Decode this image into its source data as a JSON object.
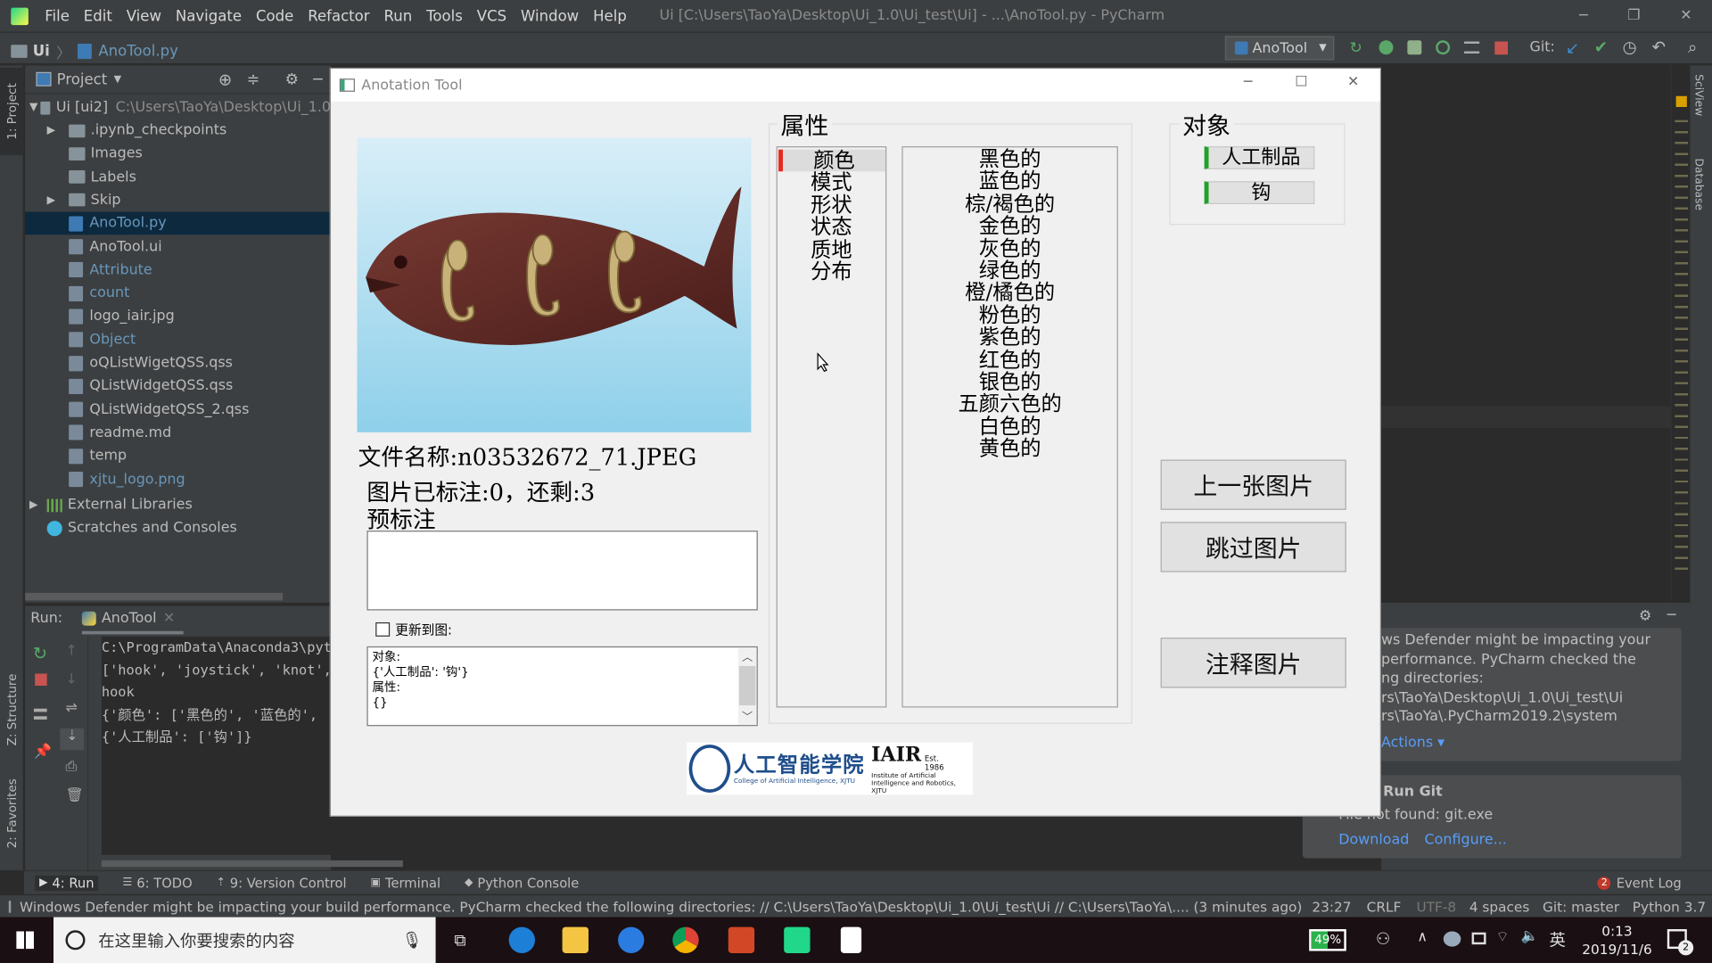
{
  "ide": {
    "menu": [
      "File",
      "Edit",
      "View",
      "Navigate",
      "Code",
      "Refactor",
      "Run",
      "Tools",
      "VCS",
      "Window",
      "Help"
    ],
    "window_title": "Ui [C:\\Users\\TaoYa\\Desktop\\Ui_1.0\\Ui_test\\Ui] - ...\\AnoTool.py - PyCharm",
    "breadcrumb": [
      "Ui",
      "AnoTool.py"
    ],
    "run_config": "AnoTool",
    "git_label": "Git:",
    "left_strip": [
      "1: Project",
      "Z: Structure",
      "2: Favorites"
    ],
    "right_strip": [
      "SciView",
      "Database"
    ],
    "project": {
      "header": "Project",
      "root": "Ui [ui2]",
      "root_path": "C:\\Users\\TaoYa\\Desktop\\Ui_1.0",
      "items": [
        {
          "label": ".ipynb_checkpoints",
          "type": "folder",
          "expandable": true
        },
        {
          "label": "Images",
          "type": "folder"
        },
        {
          "label": "Labels",
          "type": "folder"
        },
        {
          "label": "Skip",
          "type": "folder",
          "expandable": true
        },
        {
          "label": "AnoTool.py",
          "type": "py",
          "selected": true
        },
        {
          "label": "AnoTool.ui",
          "type": "file"
        },
        {
          "label": "Attribute",
          "type": "file",
          "color": "blue"
        },
        {
          "label": "count",
          "type": "file",
          "color": "blue"
        },
        {
          "label": "logo_iair.jpg",
          "type": "file"
        },
        {
          "label": "Object",
          "type": "file",
          "color": "blue"
        },
        {
          "label": "oQListWigetQSS.qss",
          "type": "file"
        },
        {
          "label": "QListWidgetQSS.qss",
          "type": "file"
        },
        {
          "label": "QListWidgetQSS_2.qss",
          "type": "file"
        },
        {
          "label": "readme.md",
          "type": "file"
        },
        {
          "label": "temp",
          "type": "file"
        },
        {
          "label": "xjtu_logo.png",
          "type": "file",
          "color": "blue"
        }
      ],
      "external": "External Libraries",
      "scratches": "Scratches and Consoles"
    },
    "run": {
      "label": "Run:",
      "tab": "AnoTool",
      "lines": [
        "C:\\ProgramData\\Anaconda3\\pyth",
        "['hook', 'joystick', 'knot',",
        "hook",
        "{'颜色': ['黑色的', '蓝色的',",
        "{'人工制品': ['钩']}"
      ]
    },
    "notifications": {
      "defender_lines": [
        "ws Defender might be impacting your",
        "performance. PyCharm checked the",
        "ng directories:",
        "rs\\TaoYa\\Desktop\\Ui_1.0\\Ui_test\\Ui",
        "rs\\TaoYa\\.PyCharm2019.2\\system"
      ],
      "actions": "Actions ▾",
      "git_title": "t Run Git",
      "git_msg": "File not found: git.exe",
      "download": "Download",
      "configure": "Configure..."
    },
    "bottom_tabs": [
      "4: Run",
      "6: TODO",
      "9: Version Control",
      "Terminal",
      "Python Console"
    ],
    "event_log": "Event Log",
    "event_count": "2",
    "status": {
      "message": "Windows Defender might be impacting your build performance. PyCharm checked the following directories: // C:\\Users\\TaoYa\\Desktop\\Ui_1.0\\Ui_test\\Ui // C:\\Users\\TaoYa\\.... (3 minutes ago)",
      "position": "23:27",
      "line_sep": "CRLF",
      "encoding": "UTF-8",
      "indent": "4 spaces",
      "git": "Git: master",
      "interpreter": "Python 3.7"
    }
  },
  "dialog": {
    "title": "Anotation Tool",
    "filename": "文件名称:n03532672_71.JPEG",
    "progress": "图片已标注:0，还剩:3",
    "pre_label": "预标注",
    "pre_label_value": "",
    "checkbox_label": "更新到图:",
    "checkbox_checked": false,
    "summary_lines": [
      "对象:",
      "{'人工制品': '钩'}",
      "属性:",
      "{}"
    ],
    "attr_group": "属性",
    "attr_categories": [
      "颜色",
      "模式",
      "形状",
      "状态",
      "质地",
      "分布"
    ],
    "attr_selected": "颜色",
    "attr_values": [
      "黑色的",
      "蓝色的",
      "棕/褐色的",
      "金色的",
      "灰色的",
      "绿色的",
      "橙/橘色的",
      "粉色的",
      "紫色的",
      "红色的",
      "银色的",
      "五颜六色的",
      "白色的",
      "黄色的"
    ],
    "obj_group": "对象",
    "objects": [
      "人工制品",
      "钩"
    ],
    "buttons": {
      "prev": "上一张图片",
      "skip": "跳过图片",
      "annotate": "注释图片"
    },
    "logo": {
      "cn": "人工智能学院",
      "en": "College of Artificial Intelligence, XJTU",
      "iair": "IAIR",
      "est": "Est. 1986",
      "iair_sub": "Institute of Artificial Intelligence and Robotics, XJTU"
    }
  },
  "taskbar": {
    "search_placeholder": "在这里输入你要搜索的内容",
    "battery": "49%",
    "ime": "英",
    "time": "0:13",
    "date": "2019/11/6",
    "notif_count": "2"
  },
  "colors": {
    "accent_red": "#e8281e",
    "accent_green": "#22a02a",
    "ide_bg": "#3c3f41",
    "link": "#589df6"
  }
}
